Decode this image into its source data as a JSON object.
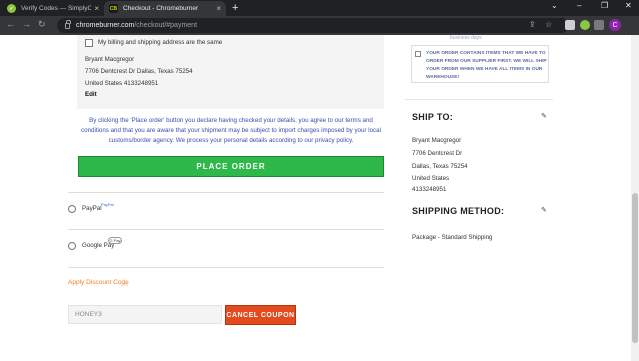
{
  "browser": {
    "tabs": [
      {
        "title": "Verify Codes — SimplyCodes",
        "favicon": "checkmark-favicon"
      },
      {
        "title": "Checkout - Chromeburner",
        "favicon": "chromeburner-favicon",
        "favicon_text": "CB"
      }
    ],
    "new_tab": "+",
    "url_host": "chromeburner.com",
    "url_path": "/checkout/#payment",
    "profile_initial": "C"
  },
  "billing": {
    "same_address_label": "My billing and shipping address are the same",
    "name": "Bryant Macgregor",
    "street": "7706 Dentcrest Dr Dallas, Texas 75254",
    "country_phone": "United States 4133248951",
    "edit_label": "Edit"
  },
  "disclaimer": "By clicking the 'Place order' button you declare having checked your details, you agree to our terms and conditions and that you are aware that your shipment may be subject to import charges imposed by your local customs/border agency. We process your personal details according to our privacy policy.",
  "place_order_label": "PLACE ORDER",
  "payment_methods": [
    {
      "label": "PayPal",
      "badge": "PayPal"
    },
    {
      "label": "Google Pay",
      "badge": "G Pay"
    }
  ],
  "discount": {
    "toggle_label": "Apply Discount Code",
    "code_value": "HONEY3",
    "cancel_label": "CANCEL COUPON"
  },
  "sidebar": {
    "faded_text": "business days",
    "notice": "YOUR ORDER CONTAINS ITEMS THAT WE HAVE TO ORDER FROM OUR SUPPLIER FIRST. WE WILL SHIP YOUR ORDER WHEN WE HAVE ALL ITEMS IN OUR WAREHOUSE!",
    "ship_to": {
      "heading": "SHIP TO:",
      "name": "Bryant Macgregor",
      "street": "7706 Dentcrest Dr",
      "city": "Dallas, Texas 75254",
      "country": "United States",
      "phone": "4133248951"
    },
    "shipping_method": {
      "heading": "SHIPPING METHOD:",
      "value": "Package - Standard Shipping"
    }
  },
  "colors": {
    "place_order": "#2eb84a",
    "cancel_coupon": "#e34b1e",
    "discount_link": "#f0822a",
    "disclaimer_text": "#3a4eb0"
  }
}
